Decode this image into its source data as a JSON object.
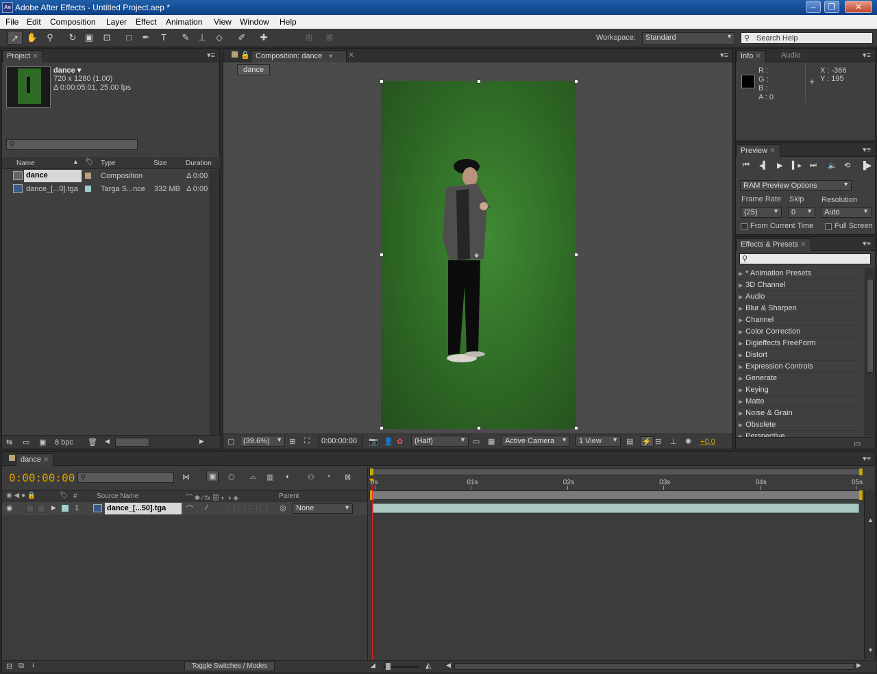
{
  "window": {
    "title": "Adobe After Effects - Untitled Project.aep *",
    "app_icon": "Ae"
  },
  "menu": [
    "File",
    "Edit",
    "Composition",
    "Layer",
    "Effect",
    "Animation",
    "View",
    "Window",
    "Help"
  ],
  "toolbar": {
    "workspace_label": "Workspace:",
    "workspace_value": "Standard",
    "search_placeholder": "Search Help"
  },
  "project": {
    "tab": "Project",
    "comp_name": "dance ▾",
    "comp_size": "720 x 1280 (1.00)",
    "comp_duration": "Δ 0:00:05:01, 25.00 fps",
    "columns": {
      "name": "Name",
      "type": "Type",
      "size": "Size",
      "duration": "Duration"
    },
    "items": [
      {
        "name": "dance",
        "type": "Composition",
        "size": "",
        "duration": "Δ 0:00",
        "color": "#b9a27a"
      },
      {
        "name": "dance_[...0].tga",
        "type": "Targa S...nce",
        "size": "332 MB",
        "duration": "Δ 0:00",
        "color": "#9fd0d0"
      }
    ],
    "bpc": "8 bpc"
  },
  "composition": {
    "tab": "Composition: dance",
    "crumb": "dance",
    "zoom": "(39.6%)",
    "timecode": "0:00:00:00",
    "resolution": "(Half)",
    "camera": "Active Camera",
    "view": "1 View",
    "exposure": "+0.0"
  },
  "info": {
    "tab_info": "Info",
    "tab_audio": "Audio",
    "r": "R :",
    "g": "G :",
    "b": "B :",
    "a": "A : 0",
    "x": "X : -366",
    "y": "Y : 195"
  },
  "preview": {
    "tab": "Preview",
    "ram_options": "RAM Preview Options",
    "frame_rate_label": "Frame Rate",
    "skip_label": "Skip",
    "resolution_label": "Resolution",
    "frame_rate": "(25)",
    "skip": "0",
    "resolution": "Auto",
    "from_current": "From Current Time",
    "full_screen": "Full Screen"
  },
  "effects": {
    "tab": "Effects & Presets",
    "items": [
      "* Animation Presets",
      "3D Channel",
      "Audio",
      "Blur & Sharpen",
      "Channel",
      "Color Correction",
      "Digieffects FreeForm",
      "Distort",
      "Expression Controls",
      "Generate",
      "Keying",
      "Matte",
      "Noise & Grain",
      "Obsolete",
      "Perspective"
    ]
  },
  "timeline": {
    "tab": "dance",
    "timecode": "0:00:00:00",
    "col_source": "Source Name",
    "col_parent": "Parent",
    "layer_num": "1",
    "layer_name": "dance_[...50].tga",
    "parent_value": "None",
    "ruler": [
      "0s",
      "01s",
      "02s",
      "03s",
      "04s",
      "05s"
    ],
    "toggle": "Toggle Switches / Modes"
  }
}
